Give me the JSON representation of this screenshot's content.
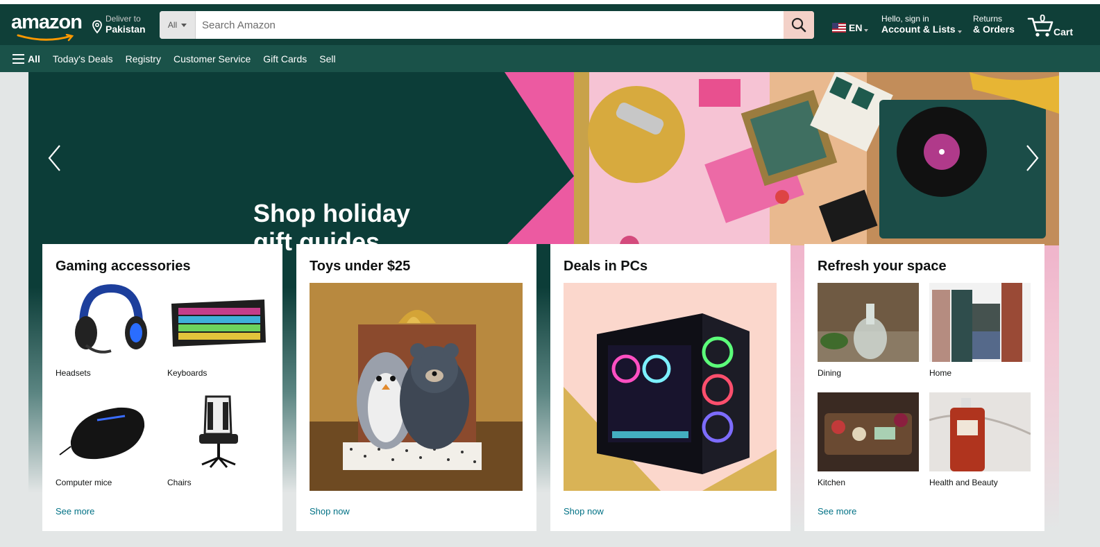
{
  "header": {
    "logo_text": "amazon",
    "deliver_small": "Deliver to",
    "deliver_big": "Pakistan",
    "search_category": "All",
    "search_placeholder": "Search Amazon",
    "language": "EN",
    "account_small": "Hello, sign in",
    "account_big": "Account & Lists",
    "returns_small": "Returns",
    "returns_big": "& Orders",
    "cart_count": "0",
    "cart_label": "Cart"
  },
  "subnav": {
    "all_label": "All",
    "items": [
      "Today's Deals",
      "Registry",
      "Customer Service",
      "Gift Cards",
      "Sell"
    ]
  },
  "hero": {
    "headline_line1": "Shop holiday",
    "headline_line2": "gift guides"
  },
  "cards": [
    {
      "title": "Gaming accessories",
      "items": [
        "Headsets",
        "Keyboards",
        "Computer mice",
        "Chairs"
      ],
      "link": "See more"
    },
    {
      "title": "Toys under $25",
      "link": "Shop now"
    },
    {
      "title": "Deals in PCs",
      "link": "Shop now"
    },
    {
      "title": "Refresh your space",
      "items": [
        "Dining",
        "Home",
        "Kitchen",
        "Health and Beauty"
      ],
      "link": "See more"
    }
  ],
  "icons": {
    "location": "location-pin-icon",
    "search": "search-icon",
    "cart": "cart-icon",
    "menu": "hamburger-menu-icon",
    "flag": "us-flag-icon"
  },
  "colors": {
    "nav_bg": "#0f3f38",
    "subnav_bg": "#1a5249",
    "search_button": "#f3d1c8",
    "link": "#007185"
  }
}
